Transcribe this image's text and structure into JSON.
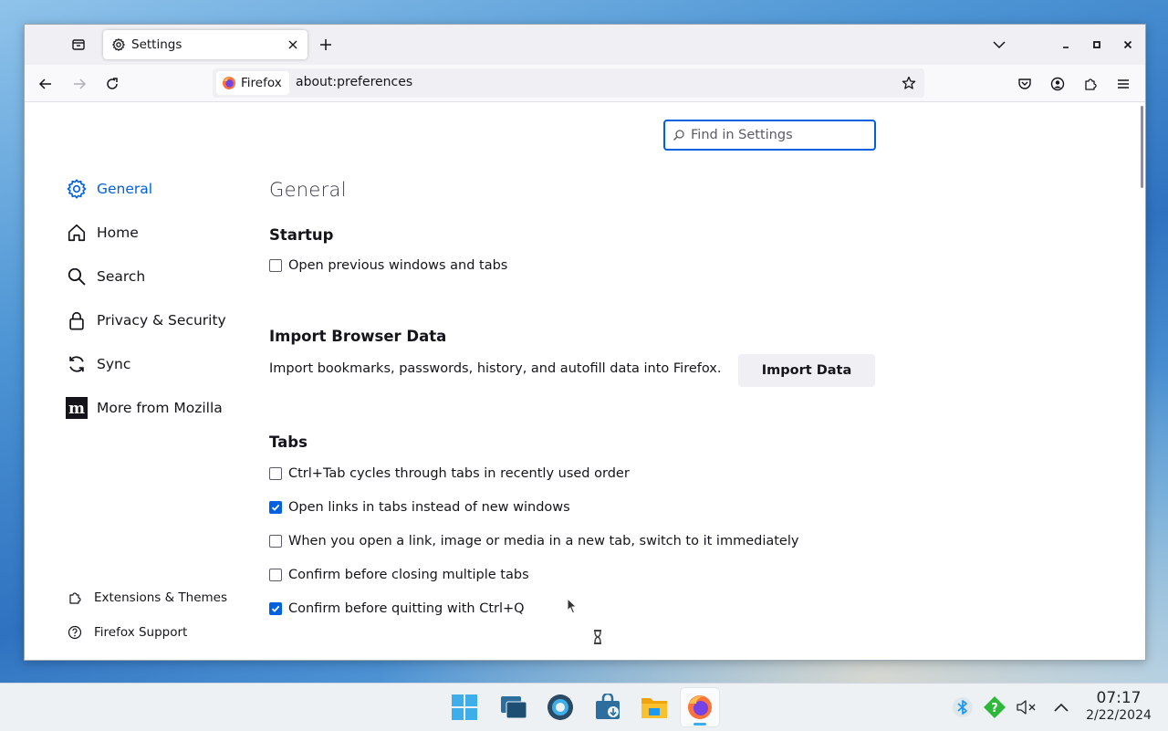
{
  "browser": {
    "tab": {
      "title": "Settings"
    },
    "identity_label": "Firefox",
    "url": "about:preferences"
  },
  "settings": {
    "search_placeholder": "Find in Settings",
    "categories": [
      {
        "label": "General",
        "icon": "gear-icon",
        "selected": true
      },
      {
        "label": "Home",
        "icon": "home-icon",
        "selected": false
      },
      {
        "label": "Search",
        "icon": "search-icon",
        "selected": false
      },
      {
        "label": "Privacy & Security",
        "icon": "lock-icon",
        "selected": false
      },
      {
        "label": "Sync",
        "icon": "sync-icon",
        "selected": false
      },
      {
        "label": "More from Mozilla",
        "icon": "mozilla-icon",
        "selected": false
      }
    ],
    "footer_links": [
      {
        "label": "Extensions & Themes",
        "icon": "puzzle-icon"
      },
      {
        "label": "Firefox Support",
        "icon": "help-icon"
      }
    ],
    "pane_title": "General",
    "startup": {
      "heading": "Startup",
      "open_previous": {
        "label": "Open previous windows and tabs",
        "checked": false
      }
    },
    "import": {
      "heading": "Import Browser Data",
      "description": "Import bookmarks, passwords, history, and autofill data into Firefox.",
      "button_label": "Import Data"
    },
    "tabs": {
      "heading": "Tabs",
      "options": [
        {
          "label": "Ctrl+Tab cycles through tabs in recently used order",
          "checked": false
        },
        {
          "label": "Open links in tabs instead of new windows",
          "checked": true
        },
        {
          "label": "When you open a link, image or media in a new tab, switch to it immediately",
          "checked": false
        },
        {
          "label": "Confirm before closing multiple tabs",
          "checked": false
        },
        {
          "label": "Confirm before quitting with Ctrl+Q",
          "checked": true
        }
      ]
    }
  },
  "taskbar": {
    "apps": [
      {
        "name": "start-menu-icon",
        "active": false
      },
      {
        "name": "task-switcher-icon",
        "active": false
      },
      {
        "name": "system-settings-icon",
        "active": false
      },
      {
        "name": "discover-store-icon",
        "active": false
      },
      {
        "name": "file-manager-icon",
        "active": false
      },
      {
        "name": "firefox-icon",
        "active": true
      }
    ],
    "clock": {
      "time": "07:17",
      "date": "2/22/2024"
    }
  },
  "colors": {
    "accent": "#0061e0",
    "text": "#15141a",
    "toolbar_bg": "#f0f0f4"
  }
}
